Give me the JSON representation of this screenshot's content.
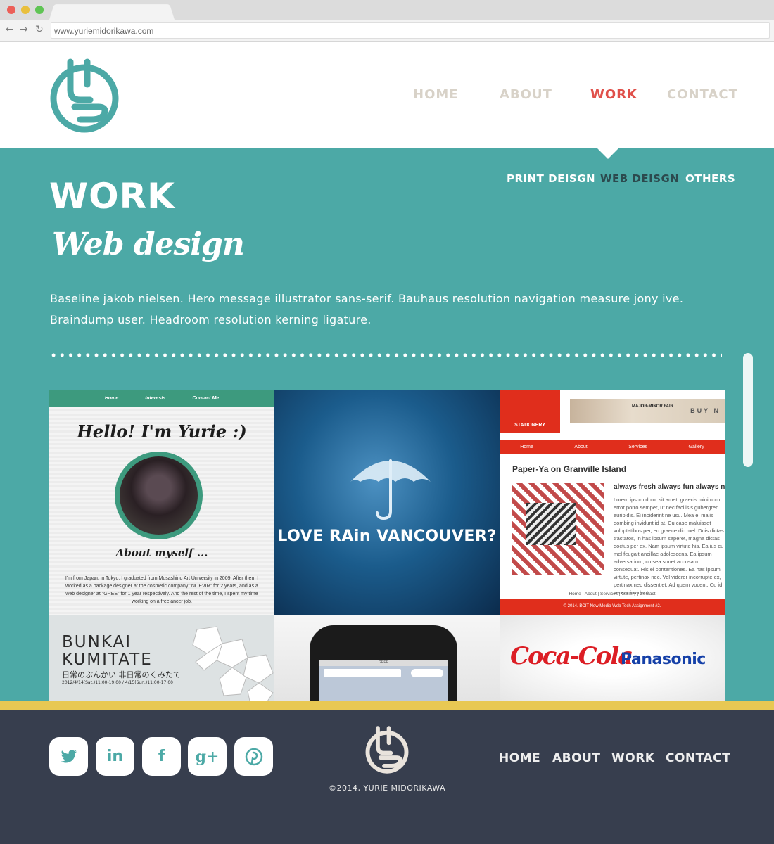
{
  "browser": {
    "url": "www.yuriemidorikawa.com",
    "back_glyph": "←",
    "forward_glyph": "→",
    "reload_glyph": "↻"
  },
  "header": {
    "nav": [
      "HOME",
      "ABOUT",
      "WORK",
      "CONTACT"
    ],
    "active": "WORK"
  },
  "hero": {
    "title": "WORK",
    "subtitle": "Web design",
    "intro": "Baseline jakob nielsen. Hero message illustrator sans-serif. Bauhaus resolution navigation measure jony ive. Braindump user. Headroom resolution kerning ligature.",
    "sub_nav": [
      "PRINT DEISGN",
      "WEB DEISGN",
      "OTHERS"
    ],
    "active_sub": "WEB DEISGN"
  },
  "gallery": {
    "hello": {
      "nav": [
        "Home",
        "Interests",
        "Contact Me"
      ],
      "heading": "Hello! I'm Yurie :)",
      "about": "About myself ...",
      "bio": "I'm from Japan, in Tokyo. I graduated from Musashino Art University in 2009. After then, I worked as a package designer at the cosmetic company \"NOEVIR\" for 2 years, and as a web designer at \"GREE\" for 1 year respectively. And the rest of the time, I spent my time working on a freelancer job."
    },
    "rain": {
      "text": "LOVE RAin VANCOUVER?"
    },
    "paperya": {
      "brand": "STATIONERY",
      "banner": "MAJOR-MINOR FAIR",
      "buy": "BUY N",
      "nav": [
        "Home",
        "About",
        "Services",
        "Gallery"
      ],
      "title": "Paper-Ya on Granville Island",
      "tagline": "always fresh always fun always n",
      "body": "Lorem ipsum dolor sit amet, graecis minimum error porro semper, ut nec facilisis gubergren euripidis. Ei inciderint ne usu. Mea ei malis dombing invidunt id at. Cu case maluisset voluptatibus per, eu graece dic mel. Duis dictas tractatos, in has ipsum saperet, magna dictas doctus per ex. Nam ipsum virtute his. Ea ius cu mel feugait ancillae adolescens. Ea ipsum adversarium, cu sea sonet accusam consequat. His ei contentiones. Ea has ipsum virtute, pertinax nec. Vel viderer incorrupte ex, pertinax nec dissentiet. Ad quem vocent. Cu id verear invidunt.",
      "footer_nav": "Home | About | Services | Gallery | Contact",
      "footer": "© 2014. BCIT New Media Web Tech Assignment #2."
    },
    "bunkai": {
      "line1": "BUNKAI",
      "line2": "KUMITATE",
      "jp": "日常のぶんかい 非日常のくみたて",
      "dates": "2012/4/14(Sat.)11:00-19:00 / 4/15(Sun.)11:00-17:00"
    },
    "phone": {
      "label": "GREE"
    },
    "brands": {
      "coke": "Coca-Cola",
      "panasonic": "Panasonic"
    }
  },
  "footer": {
    "social": [
      {
        "icon": "twitter-icon",
        "glyph": "🐦"
      },
      {
        "icon": "linkedin-icon",
        "glyph": "in"
      },
      {
        "icon": "facebook-icon",
        "glyph": "f"
      },
      {
        "icon": "google-plus-icon",
        "glyph": "g+"
      },
      {
        "icon": "pinterest-icon",
        "glyph": "P"
      }
    ],
    "copyright": "©2014, YURIE MIDORIKAWA",
    "nav": [
      "HOME",
      "ABOUT",
      "WORK",
      "CONTACT"
    ]
  },
  "colors": {
    "teal": "#4ca9a6",
    "accent_red": "#e0504a",
    "footer_bg": "#373e4e",
    "footer_stripe": "#e8c853",
    "nav_inactive": "#d8d2c8"
  }
}
